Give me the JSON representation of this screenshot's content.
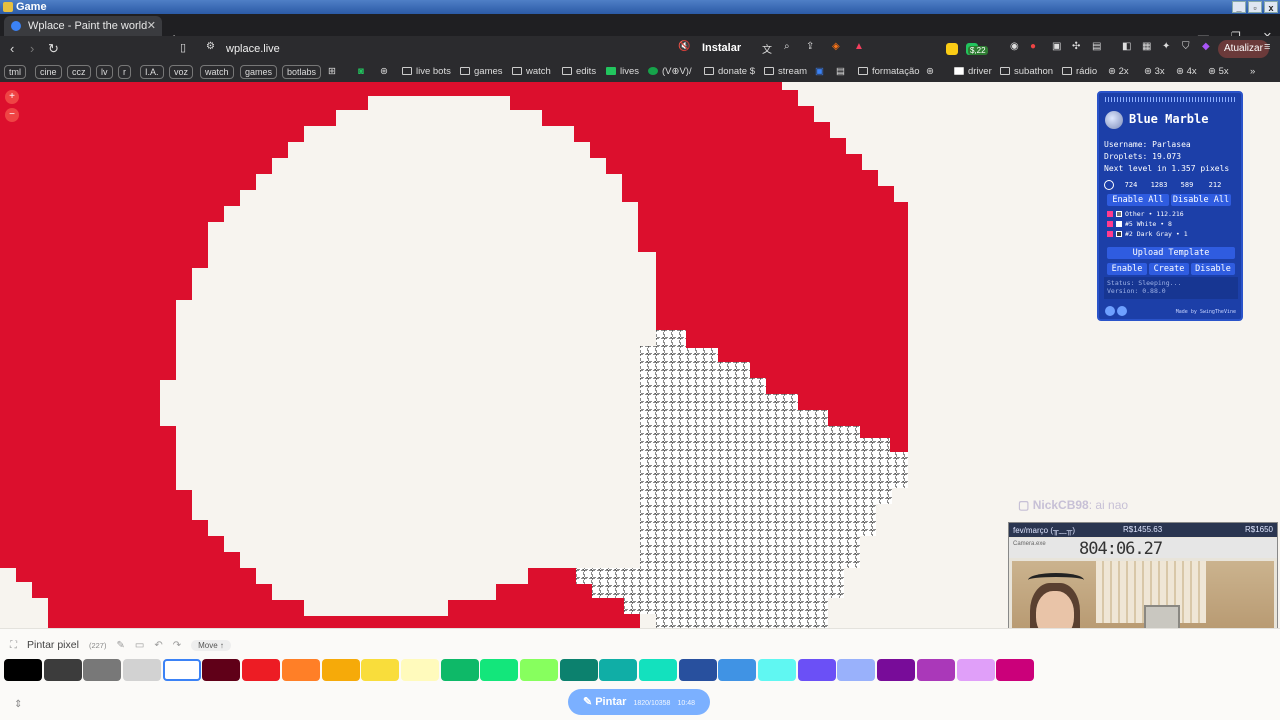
{
  "os": {
    "title": "Game"
  },
  "tab": {
    "title": "Wplace - Paint the world"
  },
  "address": {
    "url": "wplace.live",
    "install": "Instalar",
    "money": "$,22",
    "update": "Atualizar"
  },
  "bookmarks": {
    "chips": [
      "tml",
      "cine",
      "ccz",
      "lv",
      "r",
      "I.A.",
      "voz",
      "watch",
      "games",
      "botlabs"
    ],
    "folders": [
      "live bots",
      "games",
      "watch",
      "edits",
      "lives",
      "(V⊕V)/",
      "donate $",
      "stream",
      "formatação",
      "driver",
      "subathon",
      "rádio",
      "2x",
      "3x",
      "4x",
      "5x"
    ]
  },
  "colors": {
    "canvas": "#f7f4ef",
    "red": "#dc0f2d",
    "panel": "#1c3fa8",
    "paint_button": "#7bb0ff"
  },
  "panel": {
    "title": "Blue Marble",
    "username": "Username: Parlasea",
    "droplets": "Droplets: 19.073",
    "next_level": "Next level in 1.357 pixels",
    "coords": [
      "724",
      "1283",
      "589",
      "212"
    ],
    "enable_all": "Enable All",
    "disable_all": "Disable All",
    "templates": [
      "Other • 112.216",
      "#5 White • 8",
      "#2 Dark Gray • 1"
    ],
    "upload": "Upload Template",
    "enable": "Enable",
    "create": "Create",
    "disable": "Disable",
    "status": "Status: Sleeping...",
    "version": "Version: 0.88.0",
    "made_by": "Made by SwingTheVine"
  },
  "chat": {
    "user": "NickCB98",
    "message": ": ai nao"
  },
  "stream": {
    "month": "fev/março (╥﹏╥)",
    "goal_current": "R$1455.63",
    "goal_target": "R$1650",
    "camera_label": "Camera.exe",
    "timer": "804:06.27"
  },
  "toolbar": {
    "title": "Pintar pixel",
    "count": "(227)",
    "move": "Move ↑",
    "paint_label": "Pintar",
    "paint_progress": "1820/10358",
    "paint_time": "10:48",
    "palette": [
      "#000000",
      "#3c3c3c",
      "#787878",
      "#d2d2d2",
      "#ffffff",
      "#600018",
      "#ed1c24",
      "#ff7f27",
      "#f6aa09",
      "#f9dd3b",
      "#fffabc",
      "#0eb968",
      "#13e67b",
      "#87ff5e",
      "#0c816e",
      "#10aea6",
      "#13e1be",
      "#28509e",
      "#4093e4",
      "#60f7f2",
      "#6b50f6",
      "#99b1fb",
      "#780c99",
      "#aa38b9",
      "#e09ff9",
      "#cb007a"
    ],
    "selected_index": 4
  }
}
